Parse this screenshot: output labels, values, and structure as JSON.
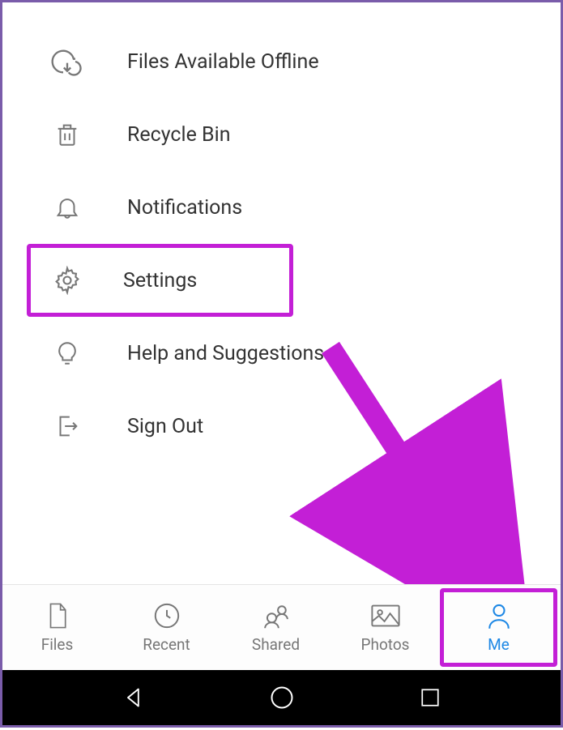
{
  "menu": {
    "items": [
      {
        "label": "Files Available Offline",
        "icon": "cloud-download"
      },
      {
        "label": "Recycle Bin",
        "icon": "trash"
      },
      {
        "label": "Notifications",
        "icon": "bell"
      },
      {
        "label": "Settings",
        "icon": "gear"
      },
      {
        "label": "Help and Suggestions",
        "icon": "lightbulb"
      },
      {
        "label": "Sign Out",
        "icon": "signout"
      }
    ],
    "highlighted_index": 3
  },
  "tabs": {
    "items": [
      {
        "label": "Files"
      },
      {
        "label": "Recent"
      },
      {
        "label": "Shared"
      },
      {
        "label": "Photos"
      },
      {
        "label": "Me"
      }
    ],
    "active_index": 4,
    "highlighted_index": 4
  },
  "highlight_color": "#c31fd6",
  "accent_color": "#1e88e5"
}
